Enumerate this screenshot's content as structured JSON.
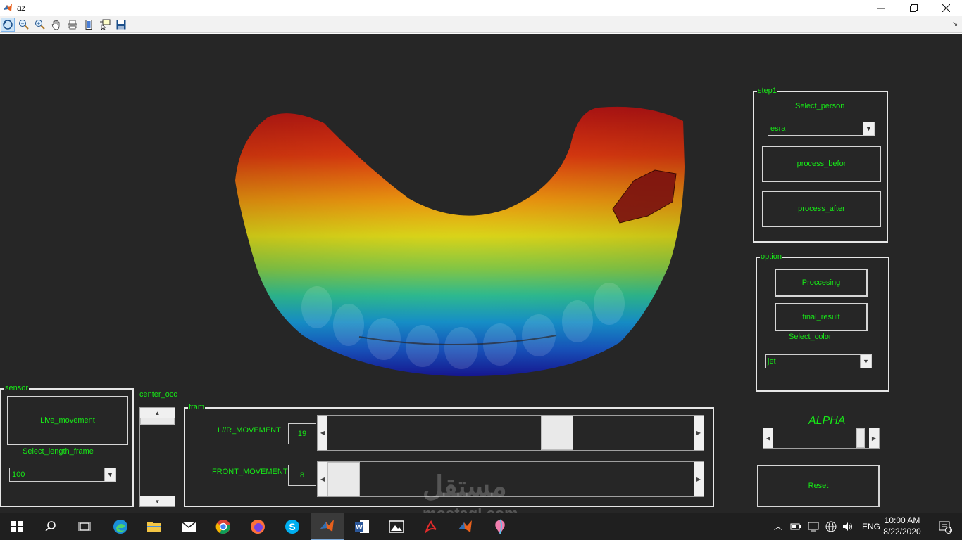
{
  "window": {
    "title": "az"
  },
  "figure": {
    "step1": {
      "title": "step1",
      "select_person_label": "Select_person",
      "person_value": "esra",
      "process_before_label": "process_befor",
      "process_after_label": "process_after"
    },
    "option": {
      "title": "option",
      "processing_label": "Proccesing",
      "final_result_label": "final_result",
      "select_color_label": "Select_color",
      "color_value": "jet"
    },
    "alpha": {
      "label": "ALPHA",
      "level": 0.95
    },
    "reset_label": "Reset",
    "sensor": {
      "title": "sensor",
      "live_movement_label": "Live_movement",
      "select_length_label": "Select_length_frame",
      "length_value": "100"
    },
    "center_occ": {
      "label": "center_occ"
    },
    "fram": {
      "title": "fram",
      "lr_label": "L//R_MOVEMENT",
      "lr_value": "19",
      "lr_level": 0.64,
      "front_label": "FRONT_MOVEMENT",
      "front_value": "8",
      "front_level": 0.0
    }
  },
  "taskbar": {
    "time": "10:00 AM",
    "date": "8/22/2020",
    "lang": "ENG",
    "notification_count": "1"
  },
  "watermark": {
    "arabic": "مستقل",
    "latin": "mostaql.com"
  },
  "colors": {
    "label_green": "#17e817",
    "background": "#262626"
  }
}
